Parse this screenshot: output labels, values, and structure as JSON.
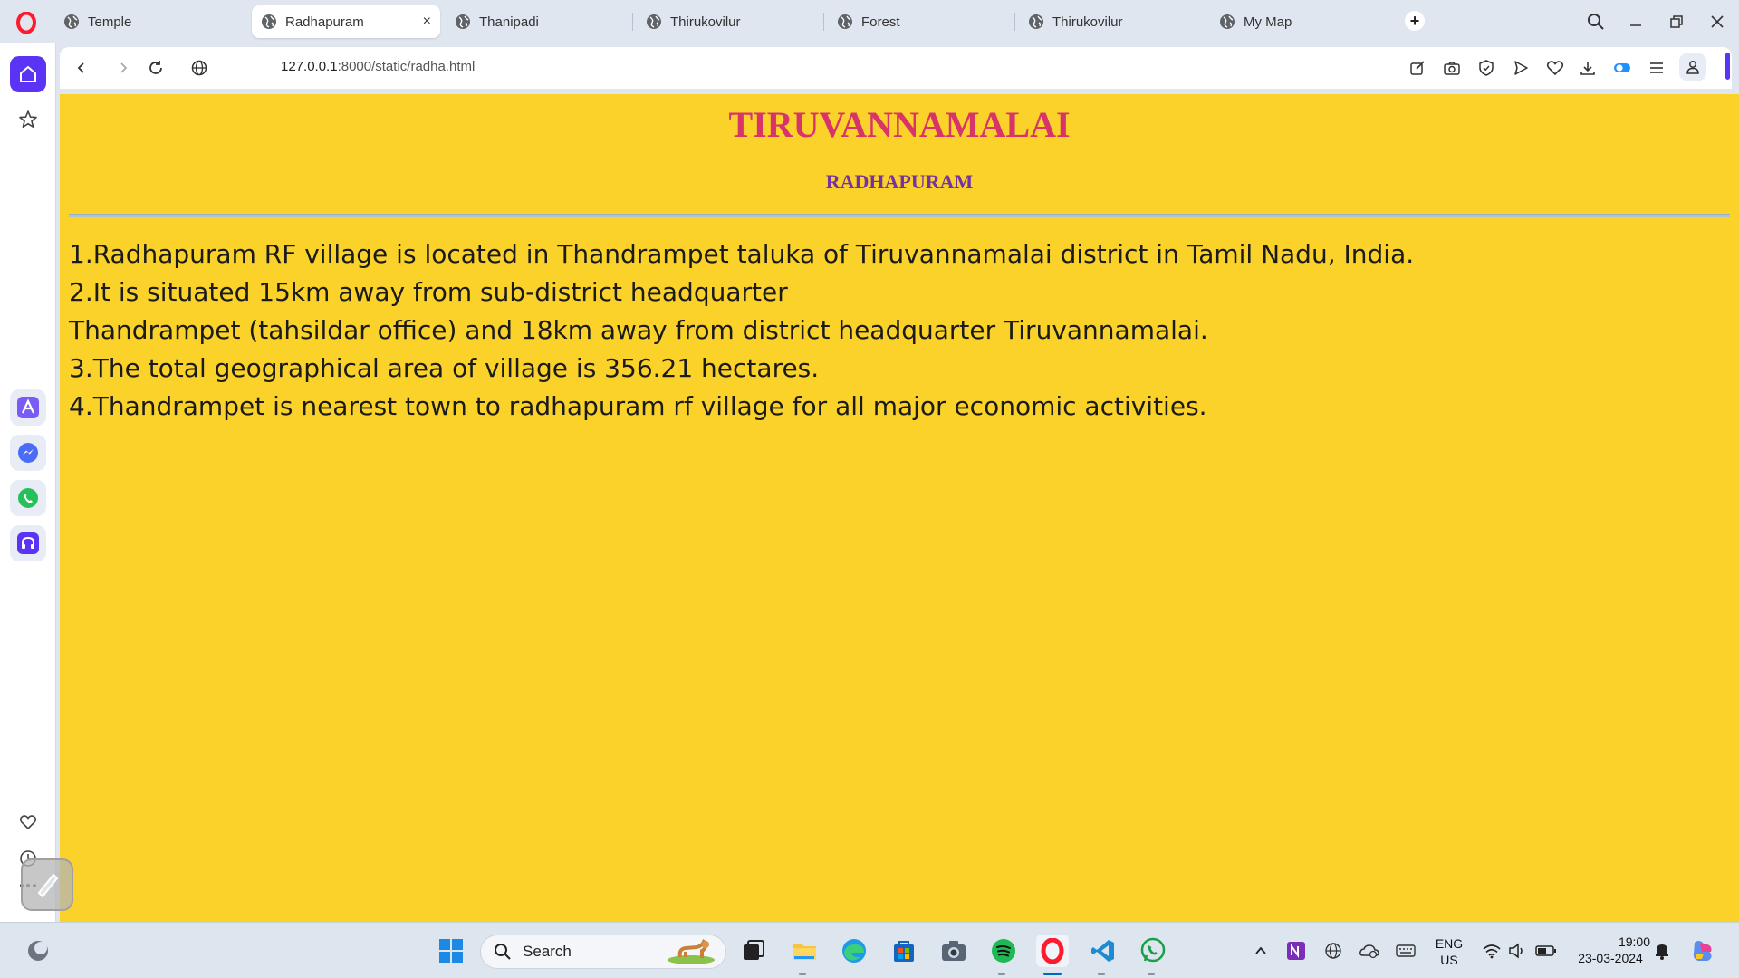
{
  "browser": {
    "tabs": [
      {
        "label": "Temple",
        "active": false
      },
      {
        "label": "Radhapuram",
        "active": true
      },
      {
        "label": "Thanipadi",
        "active": false
      },
      {
        "label": "Thirukovilur",
        "active": false
      },
      {
        "label": "Forest",
        "active": false
      },
      {
        "label": "Thirukovilur",
        "active": false
      },
      {
        "label": "My Map",
        "active": false
      }
    ],
    "tab_close": "×",
    "new_tab": "+",
    "url_host": "127.0.0.1",
    "url_path": ":8000/static/radha.html",
    "accent": "#5b33f5"
  },
  "page": {
    "title": "TIRUVANNAMALAI",
    "subtitle": "RADHAPURAM",
    "lines": [
      "1.Radhapuram RF village is located in Thandrampet taluka of Tiruvannamalai district in Tamil Nadu, India.",
      "2.It is situated 15km away from sub-district headquarter",
      "Thandrampet (tahsildar office) and 18km away from district headquarter Tiruvannamalai.",
      "3.The total geographical area of village is 356.21 hectares.",
      "4.Thandrampet is nearest town to radhapuram rf village for all major economic activities."
    ],
    "background": "#fbd22a",
    "title_color": "#d7356a",
    "subtitle_color": "#7533a0"
  },
  "taskbar": {
    "search_label": "Search",
    "lang_line1": "ENG",
    "lang_line2": "US",
    "time": "19:00",
    "date": "23-03-2024"
  }
}
